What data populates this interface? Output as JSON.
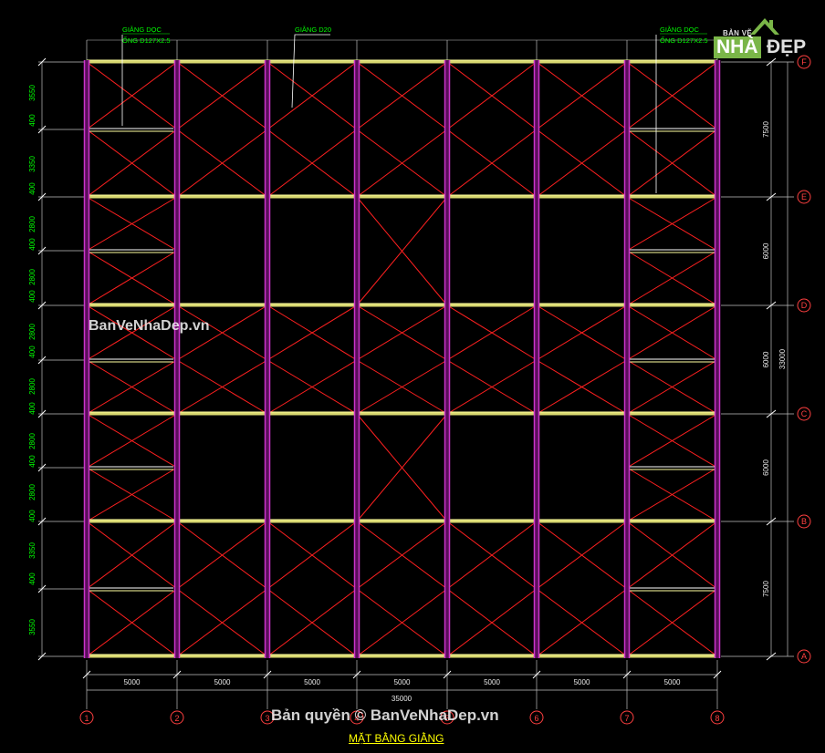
{
  "drawing": {
    "title": "MẶT BẰNG GIẰNG",
    "total_width_dim": "35000",
    "total_height_dim": "33000",
    "bay_width_dims": [
      "5000",
      "5000",
      "5000",
      "5000",
      "5000",
      "5000",
      "5000"
    ],
    "grid_columns": [
      "1",
      "2",
      "3",
      "4",
      "5",
      "6",
      "7",
      "8"
    ],
    "grid_rows": [
      "A",
      "B",
      "C",
      "D",
      "E",
      "F"
    ],
    "row_spacing_dims": [
      "7500",
      "6000",
      "6000",
      "6000",
      "7500"
    ],
    "left_segment_dims": [
      "3550",
      "400",
      "3350",
      "400",
      "2800",
      "400",
      "2800",
      "400",
      "2800",
      "400",
      "2800",
      "400",
      "2800",
      "400",
      "2800",
      "400",
      "3350",
      "400",
      "3550"
    ],
    "annotations": [
      {
        "line1": "GIẰNG DỌC",
        "line2": "ỐNG D127X2.5"
      },
      {
        "line1": "GIẰNG D20",
        "line2": ""
      },
      {
        "line1": "GIẰNG DỌC",
        "line2": "ỐNG D127X2.5"
      }
    ]
  },
  "watermarks": {
    "site": "BanVeNhaDep.vn",
    "copyright": "Bản quyền © BanVeNhaDep.vn"
  },
  "logo": {
    "small_text": "BẢN VẼ",
    "highlight_text": "NHÀ",
    "text": "ĐẸP"
  },
  "colors": {
    "background": "#000000",
    "bracing": "#ff2020",
    "column": "#cc33cc",
    "beam": "#ffffa0",
    "dimension": "#00ff00",
    "dimension_line": "#bfbfbf",
    "grid_bubble": "#ff4040",
    "title": "#ffff00"
  }
}
